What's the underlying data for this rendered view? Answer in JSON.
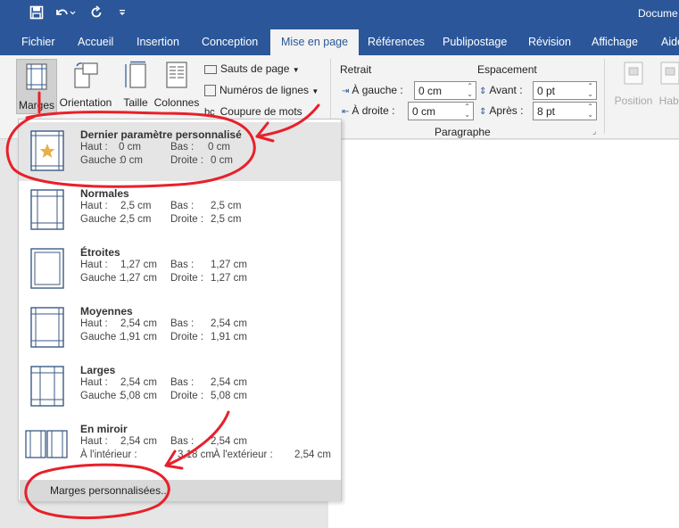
{
  "window": {
    "title": "Docume"
  },
  "quick_access": {
    "save_icon": "save-icon",
    "undo_icon": "undo-icon",
    "redo_icon": "repeat-icon",
    "customize_icon": "customize-icon"
  },
  "tabs": [
    "Fichier",
    "Accueil",
    "Insertion",
    "Conception",
    "Mise en page",
    "Références",
    "Publipostage",
    "Révision",
    "Affichage",
    "Aide"
  ],
  "active_tab": "Mise en page",
  "ribbon": {
    "margins_label": "Marges",
    "orientation_label": "Orientation",
    "size_label": "Taille",
    "columns_label": "Colonnes",
    "breaks_label": "Sauts de page",
    "line_numbers_label": "Numéros de lignes",
    "hyphenation_label": "Coupure de mots",
    "indent_title": "Retrait",
    "indent_left_label": "À gauche :",
    "indent_left_value": "0 cm",
    "indent_right_label": "À droite :",
    "indent_right_value": "0 cm",
    "spacing_title": "Espacement",
    "spacing_before_label": "Avant :",
    "spacing_before_value": "0 pt",
    "spacing_after_label": "Après :",
    "spacing_after_value": "8 pt",
    "paragraph_group_label": "Paragraphe",
    "position_label": "Position",
    "wrap_label": "Habi"
  },
  "margins_menu": {
    "options": [
      {
        "name": "Dernier paramètre personnalisé",
        "k1": "Haut :",
        "v1": "0 cm",
        "k2": "Bas :",
        "v2": "0 cm",
        "k3": "Gauche :",
        "v3": "0 cm",
        "k4": "Droite :",
        "v4": "0 cm"
      },
      {
        "name": "Normales",
        "k1": "Haut :",
        "v1": "2,5 cm",
        "k2": "Bas :",
        "v2": "2,5 cm",
        "k3": "Gauche :",
        "v3": "2,5 cm",
        "k4": "Droite :",
        "v4": "2,5 cm"
      },
      {
        "name": "Étroites",
        "k1": "Haut :",
        "v1": "1,27 cm",
        "k2": "Bas :",
        "v2": "1,27 cm",
        "k3": "Gauche :",
        "v3": "1,27 cm",
        "k4": "Droite :",
        "v4": "1,27 cm"
      },
      {
        "name": "Moyennes",
        "k1": "Haut :",
        "v1": "2,54 cm",
        "k2": "Bas :",
        "v2": "2,54 cm",
        "k3": "Gauche :",
        "v3": "1,91 cm",
        "k4": "Droite :",
        "v4": "1,91 cm"
      },
      {
        "name": "Larges",
        "k1": "Haut :",
        "v1": "2,54 cm",
        "k2": "Bas :",
        "v2": "2,54 cm",
        "k3": "Gauche :",
        "v3": "5,08 cm",
        "k4": "Droite :",
        "v4": "5,08 cm"
      },
      {
        "name": "En miroir",
        "k1": "Haut :",
        "v1": "2,54 cm",
        "k2": "Bas :",
        "v2": "2,54 cm",
        "k3": "À l'intérieur :",
        "v3": "3,18 cm",
        "k4": "À l'extérieur :",
        "v4": "2,54 cm"
      }
    ],
    "custom_margins_label": "Marges personnalisées..."
  },
  "colors": {
    "brand": "#2b579a",
    "annotation": "#e8202a"
  }
}
